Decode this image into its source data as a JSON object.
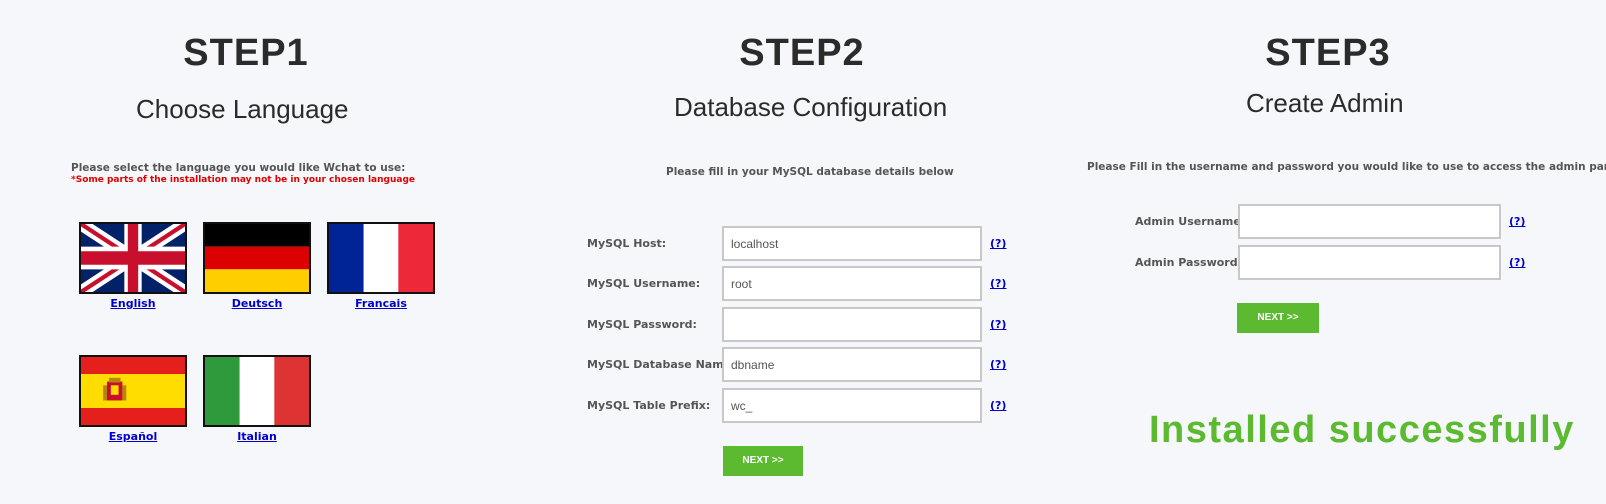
{
  "step1": {
    "title": "STEP1",
    "subtitle": "Choose Language",
    "instruction": "Please select the language you would like Wchat to use:",
    "warning": "*Some parts of the installation may not be in your chosen language",
    "languages": [
      {
        "label": "English",
        "icon": "uk-flag-icon"
      },
      {
        "label": "Deutsch",
        "icon": "germany-flag-icon"
      },
      {
        "label": "Francais",
        "icon": "france-flag-icon"
      },
      {
        "label": "Español",
        "icon": "spain-flag-icon"
      },
      {
        "label": "Italian",
        "icon": "italy-flag-icon"
      }
    ]
  },
  "step2": {
    "title": "STEP2",
    "subtitle": "Database Configuration",
    "instruction": "Please fill in your MySQL database details below",
    "fields": [
      {
        "label": "MySQL Host:",
        "value": "localhost",
        "help": "(?)"
      },
      {
        "label": "MySQL Username:",
        "value": "root",
        "help": "(?)"
      },
      {
        "label": "MySQL Password:",
        "value": "",
        "help": "(?)"
      },
      {
        "label": "MySQL Database Name:",
        "value": "dbname",
        "help": "(?)"
      },
      {
        "label": "MySQL Table Prefix:",
        "value": "wc_",
        "help": "(?)"
      }
    ],
    "next_label": "NEXT >>"
  },
  "step3": {
    "title": "STEP3",
    "subtitle": "Create Admin",
    "instruction": "Please Fill in the username and password you would like to use to access the admin panel",
    "fields": [
      {
        "label": "Admin Username:",
        "value": "",
        "help": "(?)"
      },
      {
        "label": "Admin Password:",
        "value": "",
        "help": "(?)"
      }
    ],
    "next_label": "NEXT >>",
    "success_message": "Installed successfully"
  },
  "colors": {
    "accent_green": "#5bba2f",
    "link_blue": "#0000cc",
    "warning_red": "#e00000",
    "background": "#f6f7fa"
  }
}
